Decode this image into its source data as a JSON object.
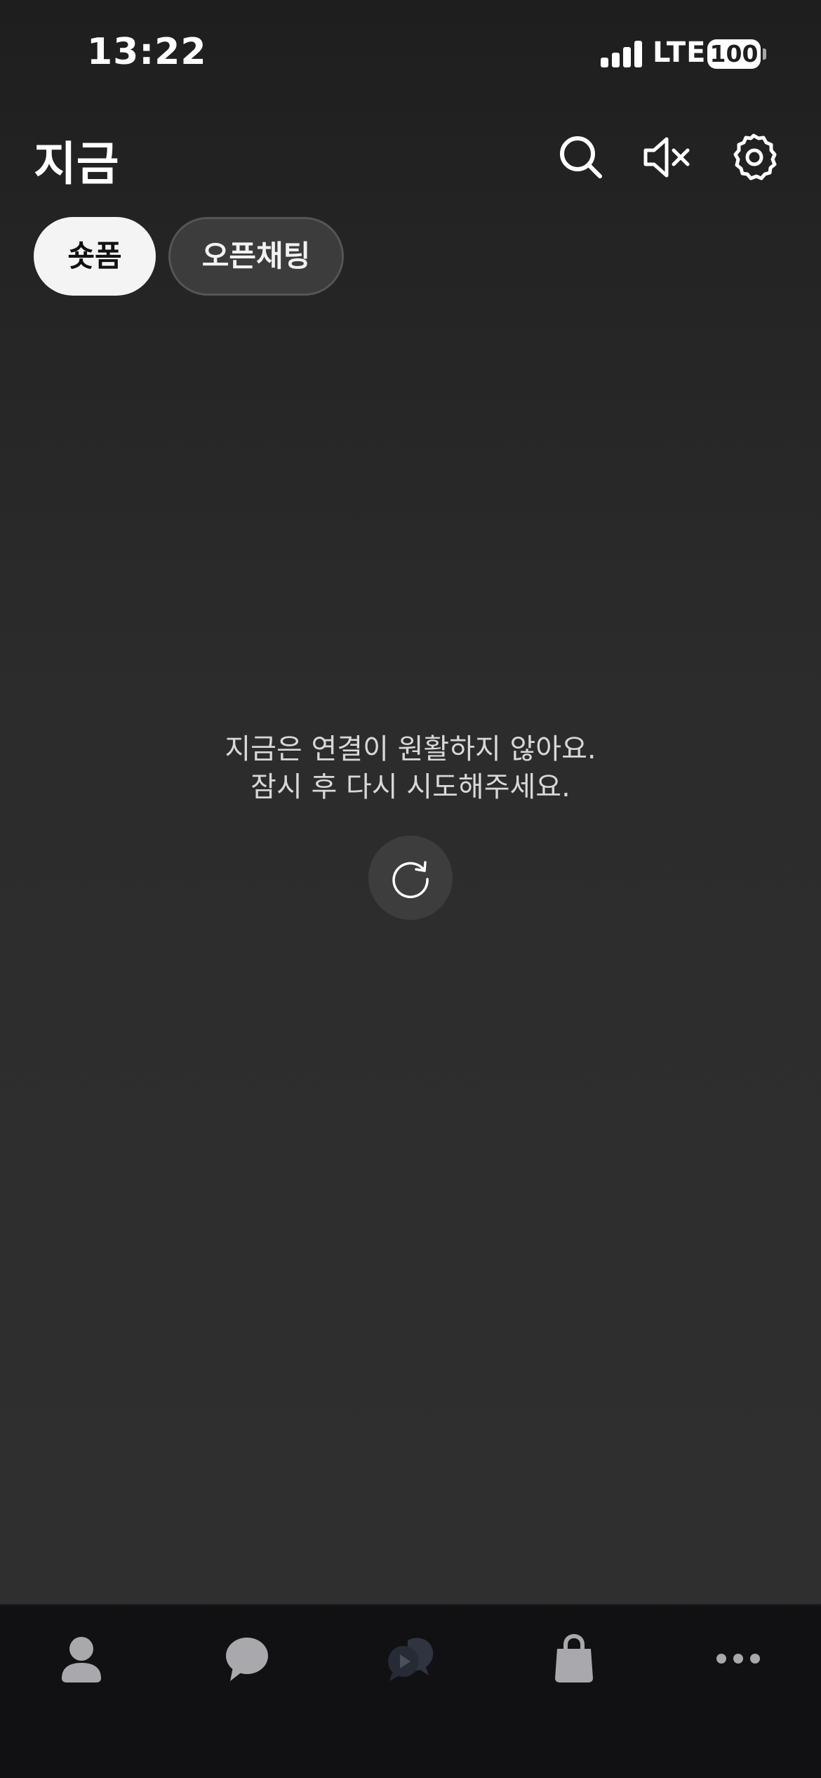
{
  "status_bar": {
    "time": "13:22",
    "network": "LTE",
    "battery": "100"
  },
  "header": {
    "title": "지금",
    "icons": [
      "search-icon",
      "mute-icon",
      "settings-icon"
    ]
  },
  "tabs": [
    {
      "label": "숏폼",
      "active": true
    },
    {
      "label": "오픈채팅",
      "active": false
    }
  ],
  "message": {
    "line1": "지금은 연결이 원활하지 않아요.",
    "line2": "잠시 후 다시 시도해주세요."
  },
  "retry_icon": "refresh-icon",
  "bottom_nav": {
    "items": [
      "friends-icon",
      "chats-icon",
      "now-icon",
      "shopping-icon",
      "more-icon"
    ],
    "active": "now-icon"
  },
  "colors": {
    "background": "#2c2c2c",
    "nav_background": "#111113",
    "active_tab_bg": "#f4f4f4",
    "inactive_tab_bg": "#3c3c3c",
    "nav_icon": "#a9a9ad",
    "nav_icon_active": "#2a2f3a"
  }
}
